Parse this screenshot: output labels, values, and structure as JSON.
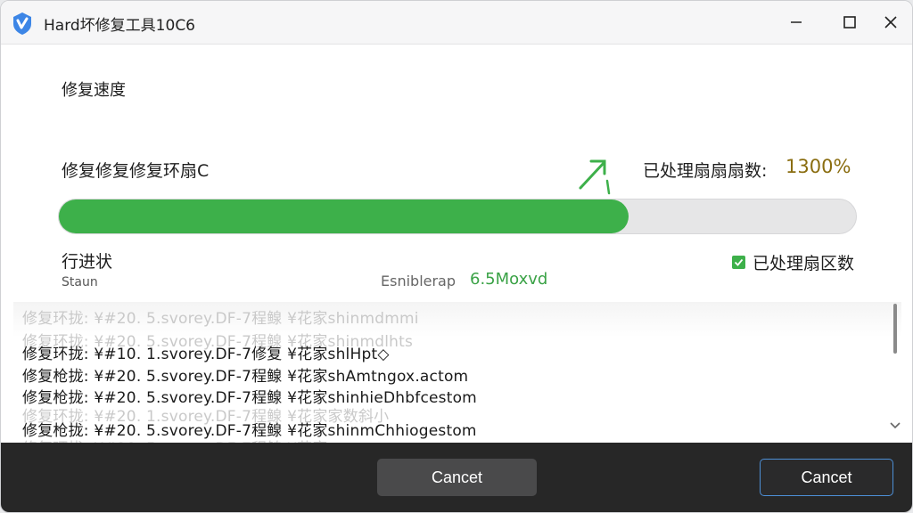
{
  "window": {
    "title": "Hard坏修复工具10C6",
    "app_icon": "shield-logo-icon"
  },
  "controls": {
    "minimize": "minimize-icon",
    "maximize": "maximize-icon",
    "close": "close-icon"
  },
  "main": {
    "section_title": "修复速度",
    "task_label": "修复修复修复环扇C",
    "count_label": "已处理扇扇扇数:",
    "count_value": "1300%",
    "progress_fraction": 0.715,
    "progress_color": "#3db04a",
    "status_label": "行进状",
    "status_sub": "Staun",
    "speed_label": "Esniblerap",
    "speed_value": "6.5Moxvd",
    "checkbox_label": "已处理扇区数",
    "checkbox_checked": true
  },
  "log": {
    "ghost_lines": [
      "修复环拢: ¥#20. 5.svorey.DF-7程鳈 ¥花家shinmdmmi",
      "修复环拢: ¥#20. 5.svorey.DF-7程鳈 ¥花家shinmdlhts",
      "修复环拢: ¥#20. 1.svorey.DF-7程鳈 ¥花家家数斜小",
      "修复环拢: ¥#20. 5.svorey.DF-7程鳈 ¥花家"
    ],
    "lines": [
      "修复环拢: ¥#10. 1.svorey.DF-7修复 ¥花家shlHpt◇",
      "修复枪拢: ¥#20. 5.svorey.DF-7程鳈 ¥花家shAmtngox.actom",
      "修复枪拢: ¥#20. 5.svorey.DF-7程鳈 ¥花家shinhieDhbfcestom",
      "修复枪拢: ¥#20. 5.svorey.DF-7程鳈 ¥花家shinmChhiogestom"
    ]
  },
  "footer": {
    "left_button": "Cancet",
    "right_button": "Cancet"
  }
}
